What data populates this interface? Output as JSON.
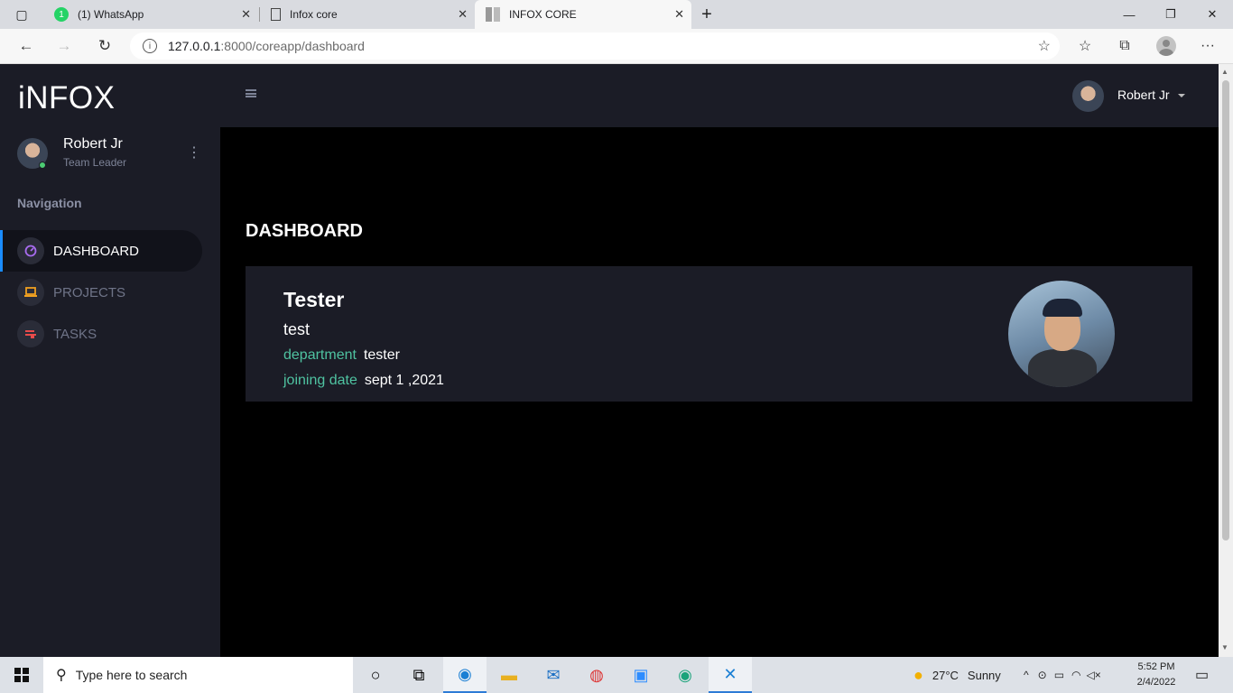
{
  "browser": {
    "tabs": [
      {
        "label": "(1) WhatsApp",
        "badge": "1"
      },
      {
        "label": "Infox core"
      },
      {
        "label": "INFOX CORE"
      }
    ],
    "url_host": "127.0.0.1",
    "url_path": ":8000/coreapp/dashboard"
  },
  "sidebar": {
    "logo": "iNFOX",
    "user_name": "Robert Jr",
    "user_role": "Team Leader",
    "nav_heading": "Navigation",
    "items": [
      {
        "label": "DASHBOARD",
        "icon": "dashboard-gauge-icon",
        "color": "#a86cf0"
      },
      {
        "label": "PROJECTS",
        "icon": "laptop-icon",
        "color": "#f0a020"
      },
      {
        "label": "TASKS",
        "icon": "message-icon",
        "color": "#e84b4b"
      }
    ]
  },
  "topbar": {
    "user_name": "Robert Jr"
  },
  "main": {
    "title": "DASHBOARD",
    "card": {
      "name": "Tester",
      "subtitle": "test",
      "department_label": "department",
      "department_value": "tester",
      "joining_label": "joining date",
      "joining_value": "sept 1 ,2021"
    }
  },
  "taskbar": {
    "search_placeholder": "Type here to search",
    "weather_temp": "27°C",
    "weather_text": "Sunny",
    "time": "5:52 PM",
    "date": "2/4/2022"
  },
  "colors": {
    "accent": "#1a8cff",
    "label_teal": "#4fc3a1",
    "sidebar_bg": "#1b1c26"
  }
}
